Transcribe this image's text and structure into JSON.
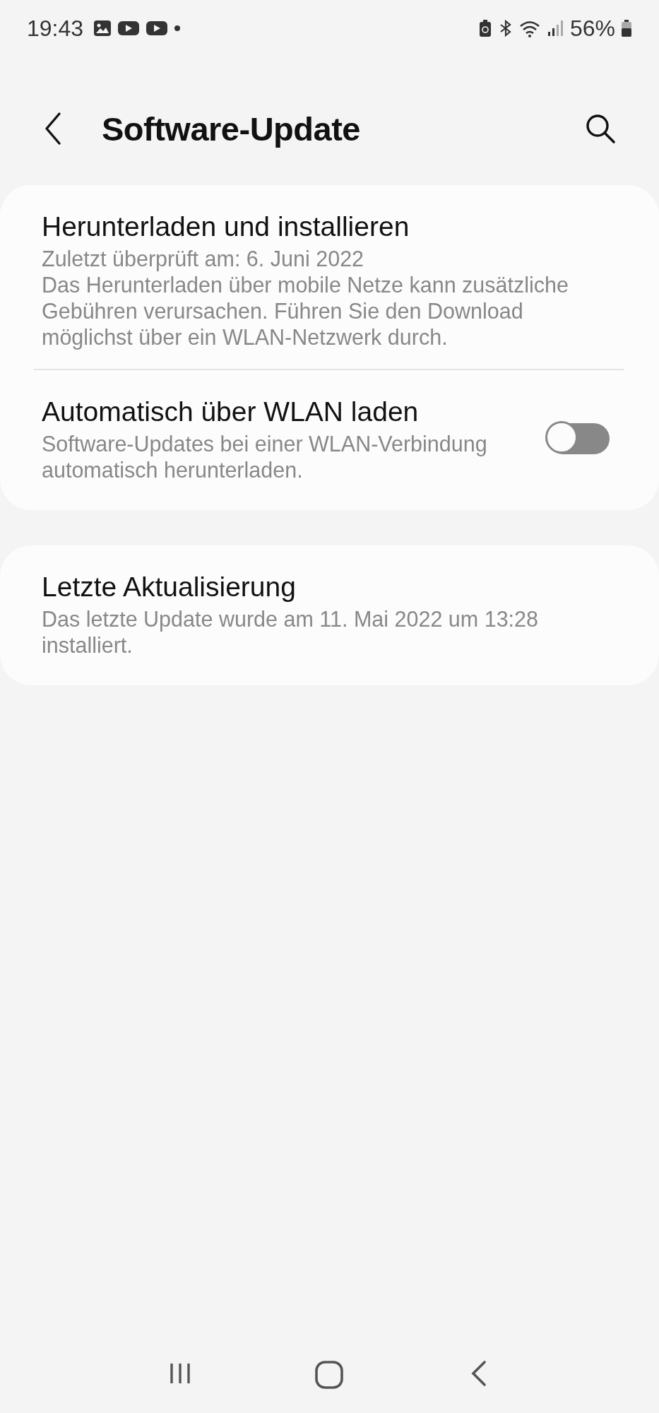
{
  "status_bar": {
    "time": "19:43",
    "battery": "56%"
  },
  "header": {
    "title": "Software-Update"
  },
  "cards": [
    {
      "items": [
        {
          "kind": "info",
          "title": "Herunterladen und installieren",
          "lines": [
            "Zuletzt überprüft am: 6. Juni 2022",
            "Das Herunterladen über mobile Netze kann zusätzliche Gebühren verursachen. Führen Sie den Download möglichst über ein WLAN-Netzwerk durch."
          ]
        },
        {
          "kind": "switch",
          "title": "Automatisch über WLAN laden",
          "lines": [
            "Software-Updates bei einer WLAN-Verbindung automatisch herunterladen."
          ],
          "on": false
        }
      ]
    },
    {
      "items": [
        {
          "kind": "info",
          "title": "Letzte Aktualisierung",
          "lines": [
            "Das letzte Update wurde am 11. Mai 2022 um 13:28 installiert."
          ]
        }
      ]
    }
  ]
}
